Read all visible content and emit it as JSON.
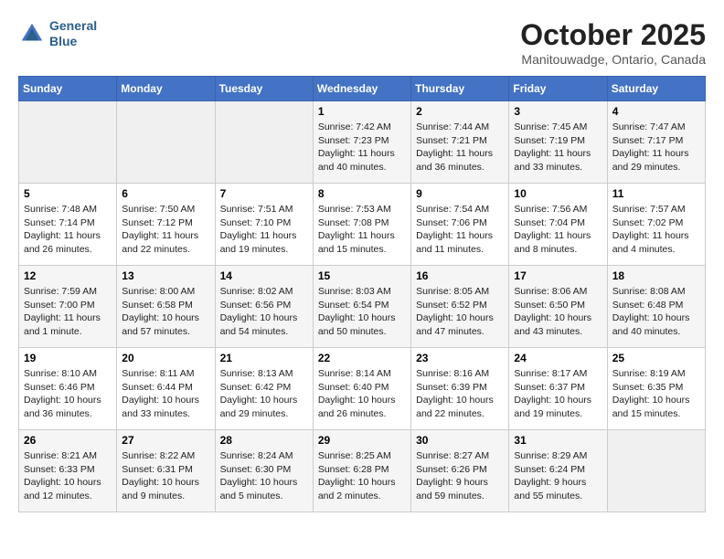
{
  "header": {
    "logo_line1": "General",
    "logo_line2": "Blue",
    "month": "October 2025",
    "location": "Manitouwadge, Ontario, Canada"
  },
  "weekdays": [
    "Sunday",
    "Monday",
    "Tuesday",
    "Wednesday",
    "Thursday",
    "Friday",
    "Saturday"
  ],
  "weeks": [
    [
      {
        "day": "",
        "info": ""
      },
      {
        "day": "",
        "info": ""
      },
      {
        "day": "",
        "info": ""
      },
      {
        "day": "1",
        "info": "Sunrise: 7:42 AM\nSunset: 7:23 PM\nDaylight: 11 hours\nand 40 minutes."
      },
      {
        "day": "2",
        "info": "Sunrise: 7:44 AM\nSunset: 7:21 PM\nDaylight: 11 hours\nand 36 minutes."
      },
      {
        "day": "3",
        "info": "Sunrise: 7:45 AM\nSunset: 7:19 PM\nDaylight: 11 hours\nand 33 minutes."
      },
      {
        "day": "4",
        "info": "Sunrise: 7:47 AM\nSunset: 7:17 PM\nDaylight: 11 hours\nand 29 minutes."
      }
    ],
    [
      {
        "day": "5",
        "info": "Sunrise: 7:48 AM\nSunset: 7:14 PM\nDaylight: 11 hours\nand 26 minutes."
      },
      {
        "day": "6",
        "info": "Sunrise: 7:50 AM\nSunset: 7:12 PM\nDaylight: 11 hours\nand 22 minutes."
      },
      {
        "day": "7",
        "info": "Sunrise: 7:51 AM\nSunset: 7:10 PM\nDaylight: 11 hours\nand 19 minutes."
      },
      {
        "day": "8",
        "info": "Sunrise: 7:53 AM\nSunset: 7:08 PM\nDaylight: 11 hours\nand 15 minutes."
      },
      {
        "day": "9",
        "info": "Sunrise: 7:54 AM\nSunset: 7:06 PM\nDaylight: 11 hours\nand 11 minutes."
      },
      {
        "day": "10",
        "info": "Sunrise: 7:56 AM\nSunset: 7:04 PM\nDaylight: 11 hours\nand 8 minutes."
      },
      {
        "day": "11",
        "info": "Sunrise: 7:57 AM\nSunset: 7:02 PM\nDaylight: 11 hours\nand 4 minutes."
      }
    ],
    [
      {
        "day": "12",
        "info": "Sunrise: 7:59 AM\nSunset: 7:00 PM\nDaylight: 11 hours\nand 1 minute."
      },
      {
        "day": "13",
        "info": "Sunrise: 8:00 AM\nSunset: 6:58 PM\nDaylight: 10 hours\nand 57 minutes."
      },
      {
        "day": "14",
        "info": "Sunrise: 8:02 AM\nSunset: 6:56 PM\nDaylight: 10 hours\nand 54 minutes."
      },
      {
        "day": "15",
        "info": "Sunrise: 8:03 AM\nSunset: 6:54 PM\nDaylight: 10 hours\nand 50 minutes."
      },
      {
        "day": "16",
        "info": "Sunrise: 8:05 AM\nSunset: 6:52 PM\nDaylight: 10 hours\nand 47 minutes."
      },
      {
        "day": "17",
        "info": "Sunrise: 8:06 AM\nSunset: 6:50 PM\nDaylight: 10 hours\nand 43 minutes."
      },
      {
        "day": "18",
        "info": "Sunrise: 8:08 AM\nSunset: 6:48 PM\nDaylight: 10 hours\nand 40 minutes."
      }
    ],
    [
      {
        "day": "19",
        "info": "Sunrise: 8:10 AM\nSunset: 6:46 PM\nDaylight: 10 hours\nand 36 minutes."
      },
      {
        "day": "20",
        "info": "Sunrise: 8:11 AM\nSunset: 6:44 PM\nDaylight: 10 hours\nand 33 minutes."
      },
      {
        "day": "21",
        "info": "Sunrise: 8:13 AM\nSunset: 6:42 PM\nDaylight: 10 hours\nand 29 minutes."
      },
      {
        "day": "22",
        "info": "Sunrise: 8:14 AM\nSunset: 6:40 PM\nDaylight: 10 hours\nand 26 minutes."
      },
      {
        "day": "23",
        "info": "Sunrise: 8:16 AM\nSunset: 6:39 PM\nDaylight: 10 hours\nand 22 minutes."
      },
      {
        "day": "24",
        "info": "Sunrise: 8:17 AM\nSunset: 6:37 PM\nDaylight: 10 hours\nand 19 minutes."
      },
      {
        "day": "25",
        "info": "Sunrise: 8:19 AM\nSunset: 6:35 PM\nDaylight: 10 hours\nand 15 minutes."
      }
    ],
    [
      {
        "day": "26",
        "info": "Sunrise: 8:21 AM\nSunset: 6:33 PM\nDaylight: 10 hours\nand 12 minutes."
      },
      {
        "day": "27",
        "info": "Sunrise: 8:22 AM\nSunset: 6:31 PM\nDaylight: 10 hours\nand 9 minutes."
      },
      {
        "day": "28",
        "info": "Sunrise: 8:24 AM\nSunset: 6:30 PM\nDaylight: 10 hours\nand 5 minutes."
      },
      {
        "day": "29",
        "info": "Sunrise: 8:25 AM\nSunset: 6:28 PM\nDaylight: 10 hours\nand 2 minutes."
      },
      {
        "day": "30",
        "info": "Sunrise: 8:27 AM\nSunset: 6:26 PM\nDaylight: 9 hours\nand 59 minutes."
      },
      {
        "day": "31",
        "info": "Sunrise: 8:29 AM\nSunset: 6:24 PM\nDaylight: 9 hours\nand 55 minutes."
      },
      {
        "day": "",
        "info": ""
      }
    ]
  ]
}
